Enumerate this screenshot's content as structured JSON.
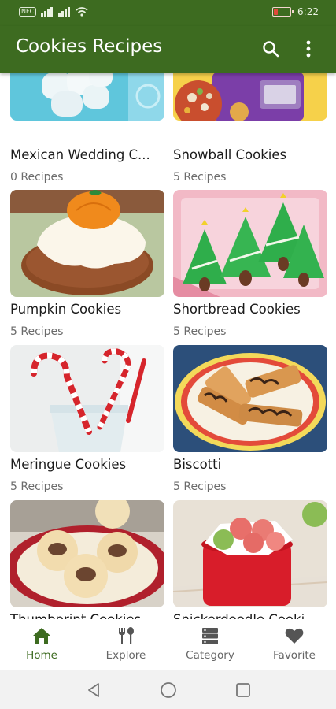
{
  "status": {
    "time": "6:22",
    "nfc": "NFC"
  },
  "app_bar": {
    "title": "Cookies Recipes",
    "accent": "#3d6b20"
  },
  "cards": [
    {
      "title": "Mexican Wedding C...",
      "count": "0 Recipes"
    },
    {
      "title": "Snowball Cookies",
      "count": "5 Recipes"
    },
    {
      "title": "Pumpkin Cookies",
      "count": "5 Recipes"
    },
    {
      "title": "Shortbread Cookies",
      "count": "5 Recipes"
    },
    {
      "title": "Meringue Cookies",
      "count": "5 Recipes"
    },
    {
      "title": "Biscotti",
      "count": "5 Recipes"
    },
    {
      "title": "Thumbprint Cookies",
      "count": ""
    },
    {
      "title": "Snickerdoodle Cooki",
      "count": ""
    }
  ],
  "bottom_nav": {
    "items": [
      {
        "label": "Home",
        "icon": "home-icon",
        "active": true
      },
      {
        "label": "Explore",
        "icon": "fork-spoon-icon",
        "active": false
      },
      {
        "label": "Category",
        "icon": "category-icon",
        "active": false
      },
      {
        "label": "Favorite",
        "icon": "heart-icon",
        "active": false
      }
    ]
  }
}
